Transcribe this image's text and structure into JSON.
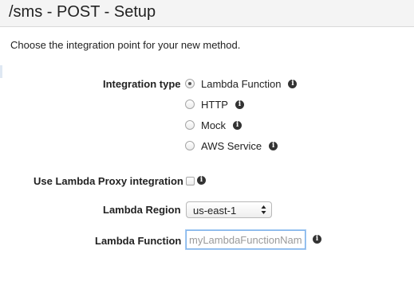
{
  "page": {
    "title": "/sms - POST - Setup",
    "intro": "Choose the integration point for your new method."
  },
  "form": {
    "integration_type": {
      "label": "Integration type",
      "options": [
        {
          "label": "Lambda Function",
          "selected": true,
          "info_icon": "info-icon"
        },
        {
          "label": "HTTP",
          "selected": false,
          "info_icon": "info-icon"
        },
        {
          "label": "Mock",
          "selected": false,
          "info_icon": "info-icon"
        },
        {
          "label": "AWS Service",
          "selected": false,
          "info_icon": "info-icon"
        }
      ]
    },
    "proxy": {
      "label": "Use Lambda Proxy integration",
      "checked": false,
      "info_icon": "info-icon"
    },
    "region": {
      "label": "Lambda Region",
      "value": "us-east-1"
    },
    "function": {
      "label": "Lambda Function",
      "value": "",
      "placeholder": "myLambdaFunctionName",
      "info_icon": "info-icon"
    }
  },
  "colors": {
    "title_bar": "#f4f4f4",
    "input_focus": "#7fb2ea",
    "info_icon": "#333333"
  }
}
